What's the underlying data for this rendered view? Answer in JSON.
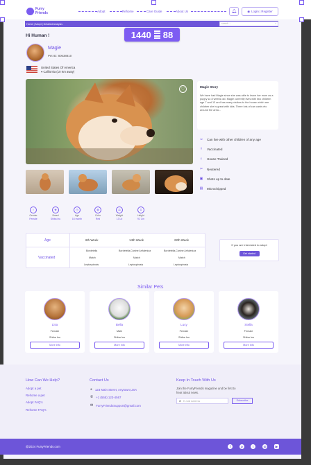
{
  "brand": {
    "name_line1": "Furry",
    "name_line2": "Friends"
  },
  "nav": {
    "items": [
      "Adopt",
      "Rehome",
      "Care Guide",
      "About Us"
    ],
    "login_label": "Login | Register"
  },
  "breadcrumb": {
    "text": "Home  |  Adopt  |  Detailed Analysis"
  },
  "search": {
    "placeholder": "search ..."
  },
  "timer": {
    "left": "1440",
    "right": "88"
  },
  "greeting": "Hi Human !",
  "pet": {
    "name": "Magie",
    "pet_id": "Pet ID: 80638810",
    "country": "United States Of America",
    "location": "California (10 Km away)"
  },
  "story": {
    "title": "Magie Story",
    "text": "We have had Magie since she was able to leave her mum as a puppy so 8 weeks old. Magie currently lives with two children age 7 and 13 and has many visitors to the house which are children she is great with kids. There lots of can cards etc around the area..."
  },
  "features": [
    {
      "icon": "people-icon",
      "label": "Can live with other children of any age"
    },
    {
      "icon": "syringe-icon",
      "label": "Vaccinated"
    },
    {
      "icon": "house-icon",
      "label": "House-Trained"
    },
    {
      "icon": "scissors-icon",
      "label": "Neutered"
    },
    {
      "icon": "camera-icon",
      "label": "Shots up to date"
    },
    {
      "icon": "chip-icon",
      "label": "Microchipped"
    }
  ],
  "stats": [
    {
      "label": "Gender",
      "value": "Female"
    },
    {
      "label": "Breed",
      "value": "Shiba Inu"
    },
    {
      "label": "Age",
      "value": "16 month"
    },
    {
      "label": "Color",
      "value": "Red"
    },
    {
      "label": "Weight",
      "value": "13 Lb"
    },
    {
      "label": "Height",
      "value": "91 Cm"
    }
  ],
  "vaccination": {
    "age_label": "Age",
    "vaccinated_label": "Vaccinated",
    "weeks": [
      "6th Week",
      "14th Week",
      "22th Week"
    ],
    "rows": [
      [
        "Bordetella",
        "Bordetella,Canine Anfuleniza",
        "Bordetella,Canine Anfuleniza"
      ],
      [
        "Match",
        "Match",
        "Match"
      ],
      [
        "Leptospirosis",
        "Leptospirosis",
        "Leptospirosis"
      ]
    ]
  },
  "interest": {
    "text": "If you are Interested to adopt",
    "button": "Get started"
  },
  "similar": {
    "title": "Similar Pets",
    "more_label": "More info",
    "pets": [
      {
        "name": "Lisa",
        "gender": "Female",
        "breed": "Shiba Inu"
      },
      {
        "name": "Bella",
        "gender": "Male",
        "breed": "Shiba Inu"
      },
      {
        "name": "Lucy",
        "gender": "Female",
        "breed": "Shiba Inu"
      },
      {
        "name": "Stella",
        "gender": "Female",
        "breed": "Shiba Inu"
      }
    ]
  },
  "footer": {
    "help_title": "How Can We Help?",
    "help_links": [
      "Adopt a pet",
      "Rehome a pet",
      "Adopt FAQ's",
      "Rehome FAQ's"
    ],
    "contact_title": "Contact Us",
    "address": "123 Main Street, Anytown,USA",
    "phone": "+1 (555) 123-4567",
    "email": "FurryFriendsSupport@gmail.com",
    "touch_title": "Keep In Touch With Us",
    "touch_text": "Join the FurryFriends magazine and be first to hear about news.",
    "email_placeholder": "E-mail Address",
    "subscribe": "Subscribe",
    "copyright": "@2024 FurryFriends.com"
  },
  "colors": {
    "accent": "#6d4fe6",
    "footer_bar": "#6d55d9",
    "background": "#f5f4fb"
  }
}
